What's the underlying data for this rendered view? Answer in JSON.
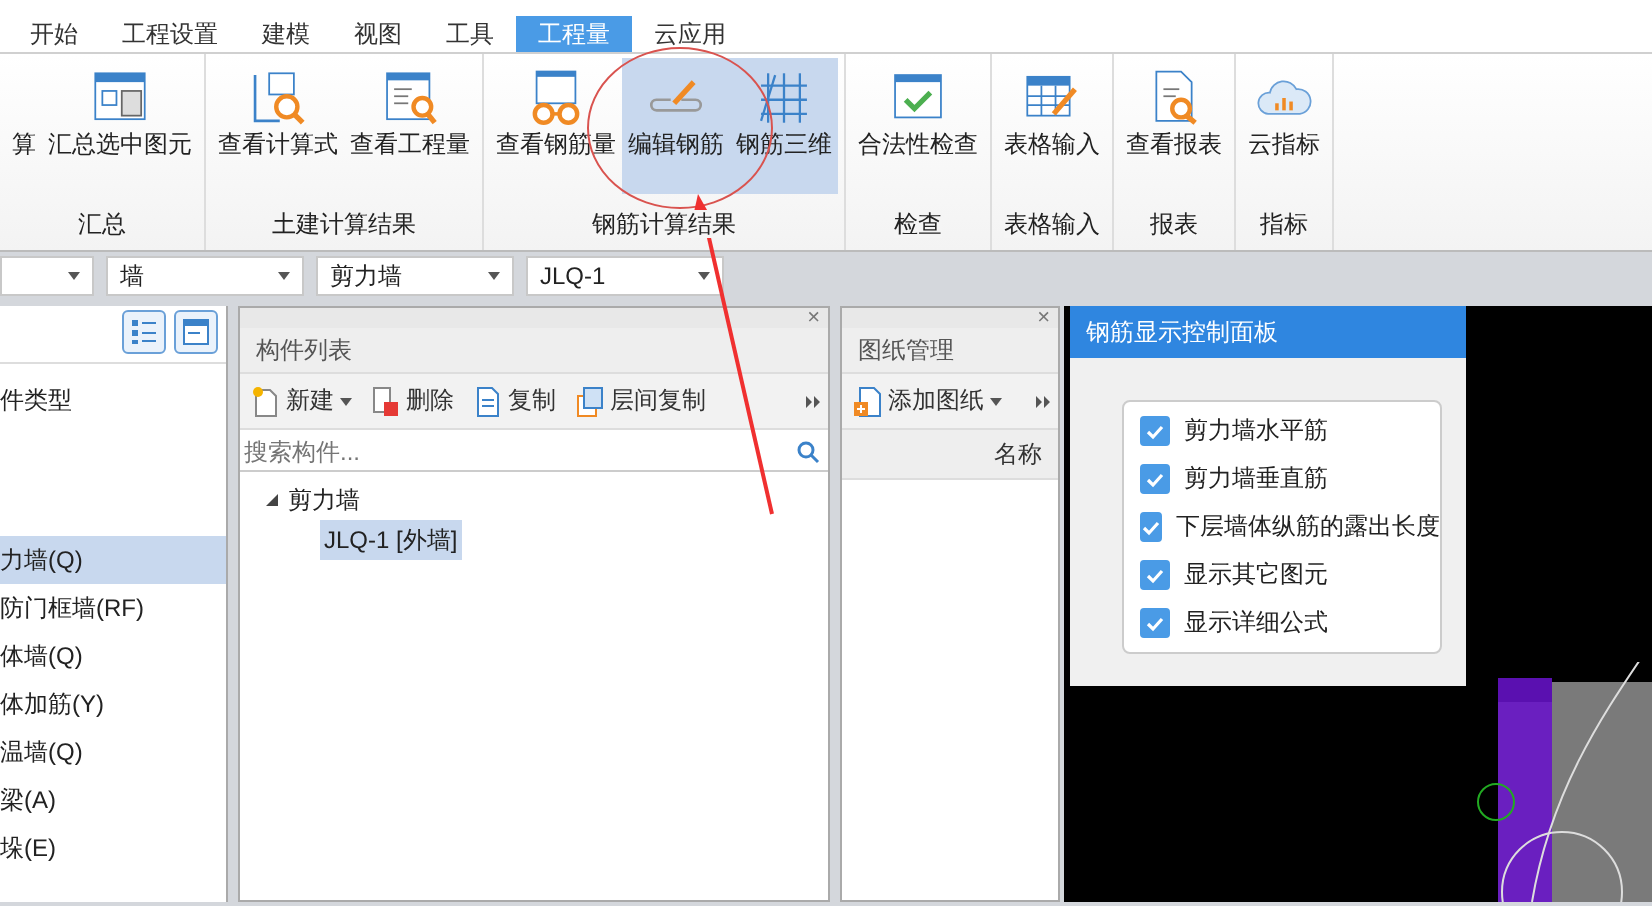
{
  "tabs": [
    {
      "label": "开始",
      "selected": false
    },
    {
      "label": "工程设置",
      "selected": false
    },
    {
      "label": "建模",
      "selected": false
    },
    {
      "label": "视图",
      "selected": false
    },
    {
      "label": "工具",
      "selected": false
    },
    {
      "label": "工程量",
      "selected": true
    },
    {
      "label": "云应用",
      "selected": false
    }
  ],
  "ribbon": {
    "groups": [
      {
        "label": "汇总",
        "buttons": [
          {
            "label": "算",
            "kind": "none",
            "selected": false
          },
          {
            "label": "汇总选中图元",
            "kind": "calc",
            "selected": false
          }
        ]
      },
      {
        "label": "土建计算结果",
        "buttons": [
          {
            "label": "查看计算式",
            "kind": "formula",
            "selected": false
          },
          {
            "label": "查看工程量",
            "kind": "quantity",
            "selected": false
          }
        ]
      },
      {
        "label": "钢筋计算结果",
        "buttons": [
          {
            "label": "查看钢筋量",
            "kind": "glasses",
            "selected": false
          },
          {
            "label": "编辑钢筋",
            "kind": "edit",
            "selected": true
          },
          {
            "label": "钢筋三维",
            "kind": "grid",
            "selected": true
          }
        ]
      },
      {
        "label": "检查",
        "buttons": [
          {
            "label": "合法性检查",
            "kind": "check",
            "selected": false
          }
        ]
      },
      {
        "label": "表格输入",
        "buttons": [
          {
            "label": "表格输入",
            "kind": "table",
            "selected": false
          }
        ]
      },
      {
        "label": "报表",
        "buttons": [
          {
            "label": "查看报表",
            "kind": "report",
            "selected": false
          }
        ]
      },
      {
        "label": "指标",
        "buttons": [
          {
            "label": "云指标",
            "kind": "cloud",
            "selected": false
          }
        ]
      }
    ]
  },
  "selectors": [
    {
      "value": "墙"
    },
    {
      "value": "剪力墙"
    },
    {
      "value": "JLQ-1"
    }
  ],
  "component_types": {
    "heading": "件类型",
    "items": [
      {
        "label": "力墙(Q)",
        "selected": true
      },
      {
        "label": "防门框墙(RF)",
        "selected": false
      },
      {
        "label": "体墙(Q)",
        "selected": false
      },
      {
        "label": "体加筋(Y)",
        "selected": false
      },
      {
        "label": "温墙(Q)",
        "selected": false
      },
      {
        "label": "梁(A)",
        "selected": false
      },
      {
        "label": "垛(E)",
        "selected": false
      }
    ]
  },
  "component_list": {
    "title": "构件列表",
    "close": "×",
    "toolbar": [
      {
        "label": "新建",
        "kind": "new",
        "dropdown": true
      },
      {
        "label": "删除",
        "kind": "delete",
        "dropdown": false
      },
      {
        "label": "复制",
        "kind": "copy",
        "dropdown": false
      },
      {
        "label": "层间复制",
        "kind": "floorcopy",
        "dropdown": false
      }
    ],
    "search": {
      "placeholder": "搜索构件..."
    },
    "tree": [
      {
        "label": "剪力墙",
        "expanded": true,
        "selected": false,
        "children": [
          {
            "label": "JLQ-1 [外墙]",
            "selected": true
          }
        ]
      }
    ]
  },
  "drawing_manager": {
    "title": "图纸管理",
    "close": "×",
    "toolbar": [
      {
        "label": "添加图纸",
        "kind": "add",
        "dropdown": true
      }
    ],
    "columns": [
      "名称"
    ]
  },
  "rebar_panel": {
    "title": "钢筋显示控制面板",
    "options": [
      {
        "label": "剪力墙水平筋",
        "checked": true
      },
      {
        "label": "剪力墙垂直筋",
        "checked": true
      },
      {
        "label": "下层墙体纵筋的露出长度",
        "checked": true
      },
      {
        "label": "显示其它图元",
        "checked": true
      },
      {
        "label": "显示详细公式",
        "checked": true
      }
    ]
  }
}
